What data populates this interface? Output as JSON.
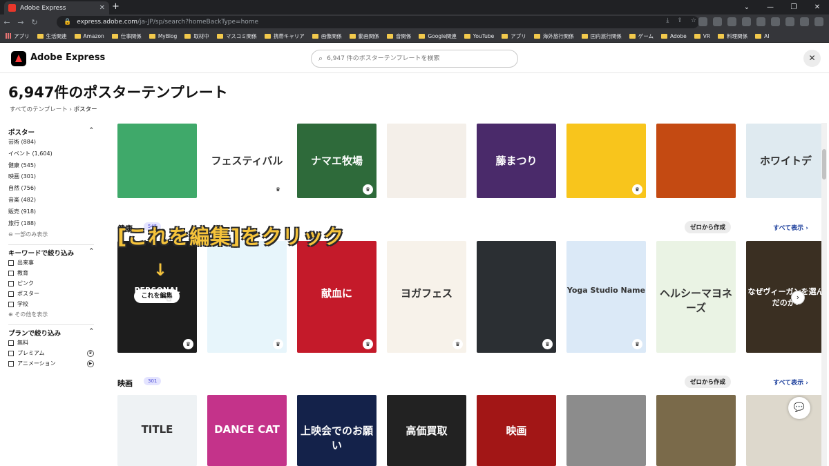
{
  "browser": {
    "tab_title": "Adobe Express",
    "url_host": "express.adobe.com",
    "url_path": "/ja-JP/sp/search?homeBackType=home",
    "bookmarks": [
      "アプリ",
      "生活関連",
      "Amazon",
      "仕事関係",
      "MyBlog",
      "取材中",
      "マスコミ関係",
      "携帯キャリア",
      "画像関係",
      "動画関係",
      "音関係",
      "Google関連",
      "YouTube",
      "アプリ",
      "海外旅行関係",
      "国内旅行関係",
      "ゲーム",
      "Adobe",
      "VR",
      "料理関係",
      "AI"
    ]
  },
  "app": {
    "brand": "Adobe Express",
    "search_placeholder": "6,947 件のポスターテンプレートを検索"
  },
  "page": {
    "title": "6,947件のポスターテンプレート",
    "breadcrumb_root": "すべてのテンプレート",
    "breadcrumb_current": "ポスター"
  },
  "sidebar": {
    "poster_heading": "ポスター",
    "poster_items": [
      "芸術 (884)",
      "イベント (1,604)",
      "健康 (545)",
      "映画 (301)",
      "自然 (756)",
      "音楽 (482)",
      "販売 (918)",
      "旅行 (188)"
    ],
    "poster_less": "一部のみ表示",
    "keyword_heading": "キーワードで絞り込み",
    "keyword_items": [
      "出来事",
      "教育",
      "ピンク",
      "ポスター",
      "学校"
    ],
    "keyword_more": "その他を表示",
    "plan_heading": "プランで絞り込み",
    "plan_items": [
      "無料",
      "プレミアム",
      "アニメーション"
    ]
  },
  "sections": {
    "health": {
      "name": "健康",
      "count": "545",
      "create": "ゼロから作成",
      "view_all": "すべて表示"
    },
    "movie": {
      "name": "映画",
      "count": "301",
      "create": "ゼロから作成",
      "view_all": "すべて表示"
    }
  },
  "cards_top": [
    {
      "bg": "#3fa96a",
      "text": ""
    },
    {
      "bg": "#ffffff",
      "text": "フェスティバル"
    },
    {
      "bg": "#2e6a3a",
      "text": "ナマエ牧場"
    },
    {
      "bg": "#f4efe9",
      "text": ""
    },
    {
      "bg": "#4a2a6a",
      "text": "藤まつり"
    },
    {
      "bg": "#f8c51c",
      "text": ""
    },
    {
      "bg": "#c44a12",
      "text": ""
    },
    {
      "bg": "#dfeaf0",
      "text": "ホワイトデ"
    }
  ],
  "cards_health": [
    {
      "bg": "#1d1d1d",
      "text": "PERSONAL TRAINING"
    },
    {
      "bg": "#e7f5fb",
      "text": ""
    },
    {
      "bg": "#c41a2a",
      "text": "献血に"
    },
    {
      "bg": "#f7f2ea",
      "text": "ヨガフェス"
    },
    {
      "bg": "#2b2f33",
      "text": ""
    },
    {
      "bg": "#dbe9f7",
      "text": "Yoga Studio Name"
    },
    {
      "bg": "#eaf3e4",
      "text": "ヘルシーマヨネーズ"
    },
    {
      "bg": "#3a2f22",
      "text": "なぜヴィーガンを選んだのか?"
    }
  ],
  "cards_movie": [
    {
      "bg": "#eef2f4",
      "text": "TITLE"
    },
    {
      "bg": "#c4338a",
      "text": "DANCE CAT"
    },
    {
      "bg": "#14224a",
      "text": "上映会でのお願い"
    },
    {
      "bg": "#222222",
      "text": "高価買取"
    },
    {
      "bg": "#a21616",
      "text": "映画"
    },
    {
      "bg": "#8c8c8c",
      "text": ""
    },
    {
      "bg": "#7a6a4a",
      "text": ""
    },
    {
      "bg": "#ddd8cc",
      "text": ""
    }
  ],
  "annotation": {
    "caption": "[これを編集]をクリック",
    "arrow": "↓",
    "edit_button": "これを編集"
  },
  "colors": {
    "accent": "#1c3f9c",
    "annotation": "#f5c33b"
  }
}
